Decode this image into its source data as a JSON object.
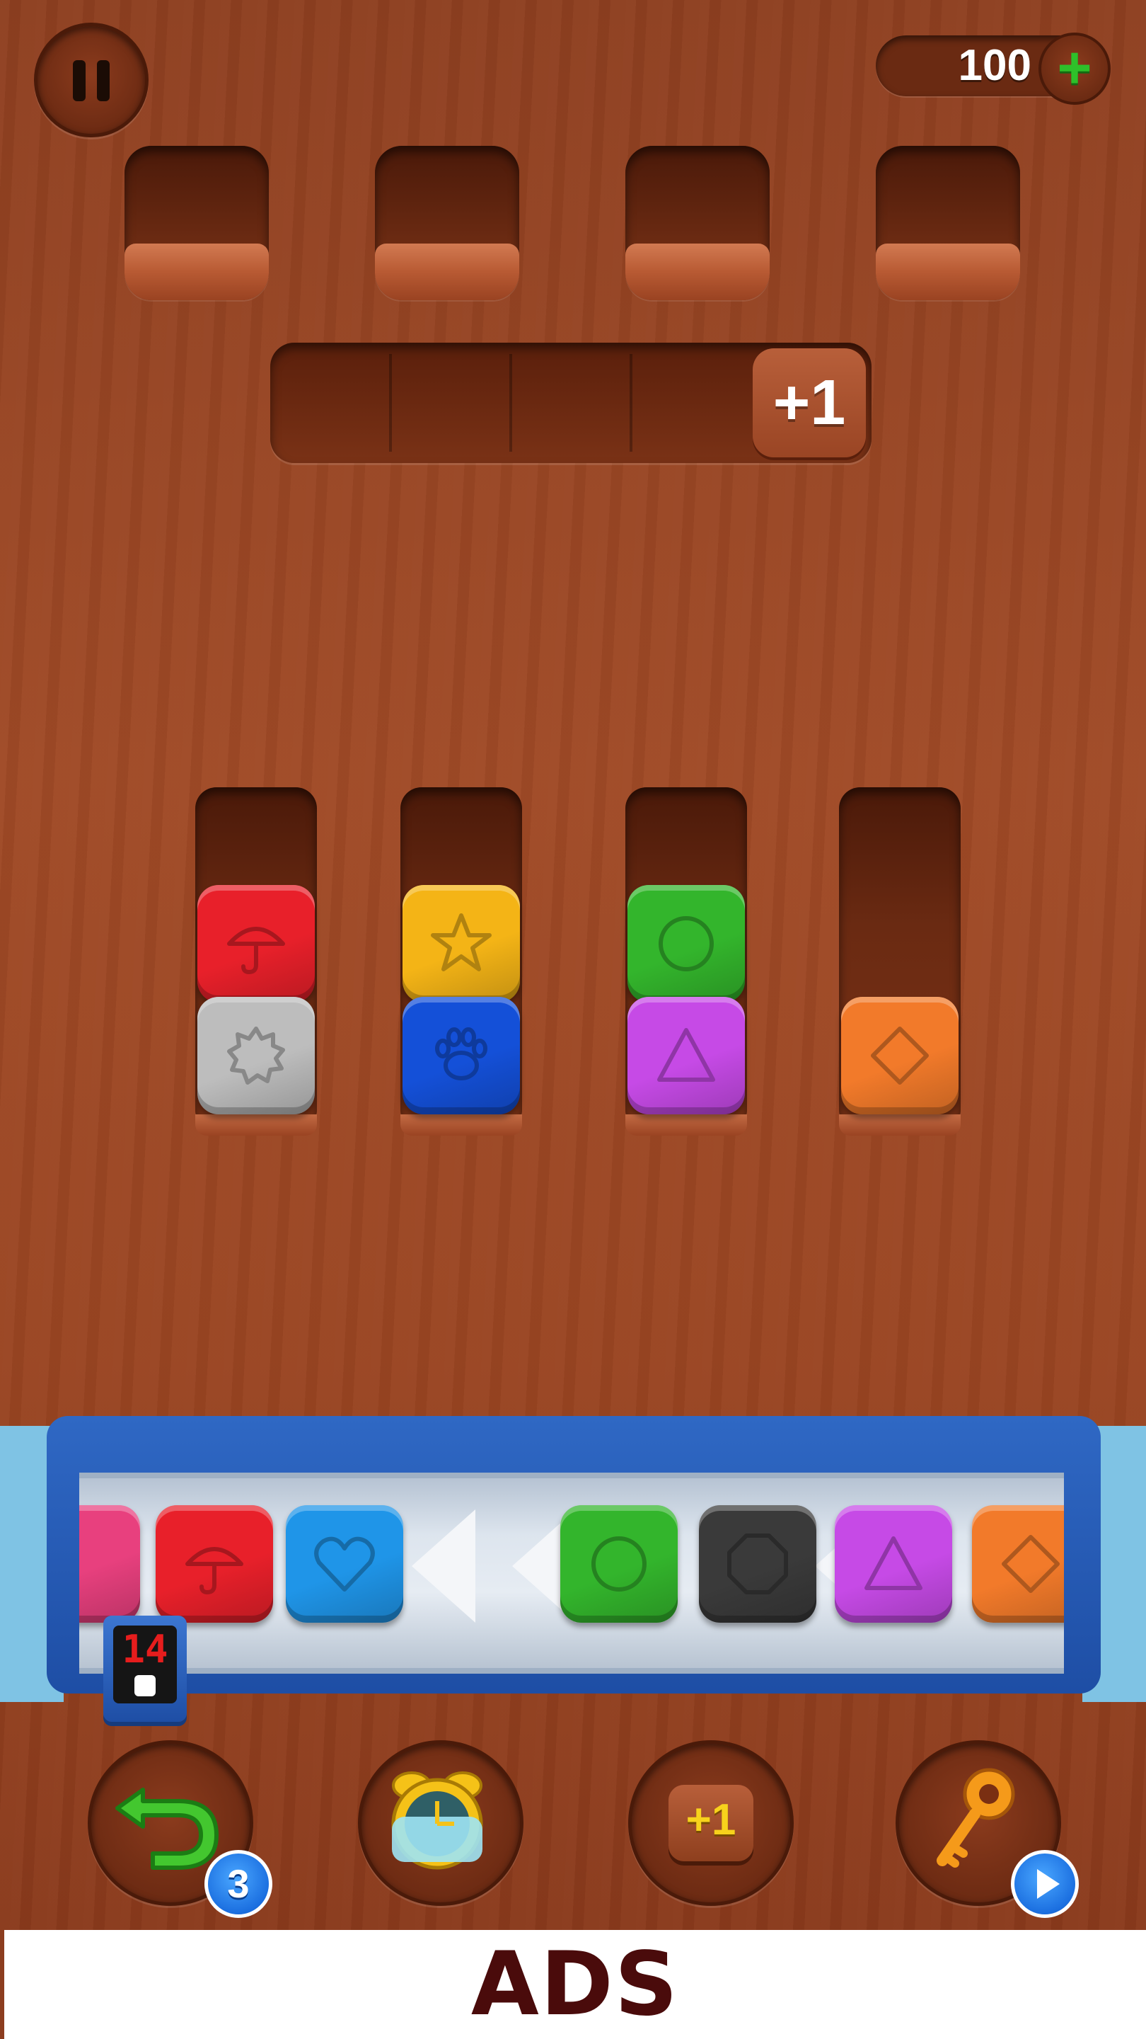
{
  "hud": {
    "coins": "100",
    "extra_slot_label": "+1"
  },
  "slots_top": [
    "empty",
    "empty",
    "empty",
    "empty"
  ],
  "tubes": [
    {
      "tiles": [
        {
          "color": "red",
          "symbol": "umbrella"
        },
        {
          "color": "silver",
          "symbol": "gear"
        }
      ]
    },
    {
      "tiles": [
        {
          "color": "yellow",
          "symbol": "star"
        },
        {
          "color": "blue",
          "symbol": "paw"
        }
      ]
    },
    {
      "tiles": [
        {
          "color": "green",
          "symbol": "circle"
        },
        {
          "color": "purple",
          "symbol": "triangle"
        }
      ]
    },
    {
      "tiles": [
        {
          "color": "orange",
          "symbol": "diamond"
        }
      ]
    }
  ],
  "conveyor": {
    "counter": "14",
    "tiles": [
      {
        "color": "pink",
        "symbol": "partial"
      },
      {
        "color": "red",
        "symbol": "umbrella"
      },
      {
        "color": "light-blue",
        "symbol": "heart"
      },
      {
        "color": "green",
        "symbol": "circle"
      },
      {
        "color": "black",
        "symbol": "octagon"
      },
      {
        "color": "purple",
        "symbol": "triangle"
      },
      {
        "color": "orange",
        "symbol": "diamond"
      }
    ]
  },
  "powerups": {
    "undo_count": "3",
    "add_slot_label": "+1"
  },
  "ad_banner": {
    "text": "ADS"
  },
  "colors": {
    "red": "#e8202a",
    "silver": "#bdbdbd",
    "yellow": "#f4b416",
    "blue": "#1450d8",
    "green": "#33b52c",
    "purple": "#c64ae6",
    "orange": "#f27a2a",
    "light-blue": "#1f95e8",
    "black": "#3a3a3a",
    "pink": "#e8407e"
  }
}
